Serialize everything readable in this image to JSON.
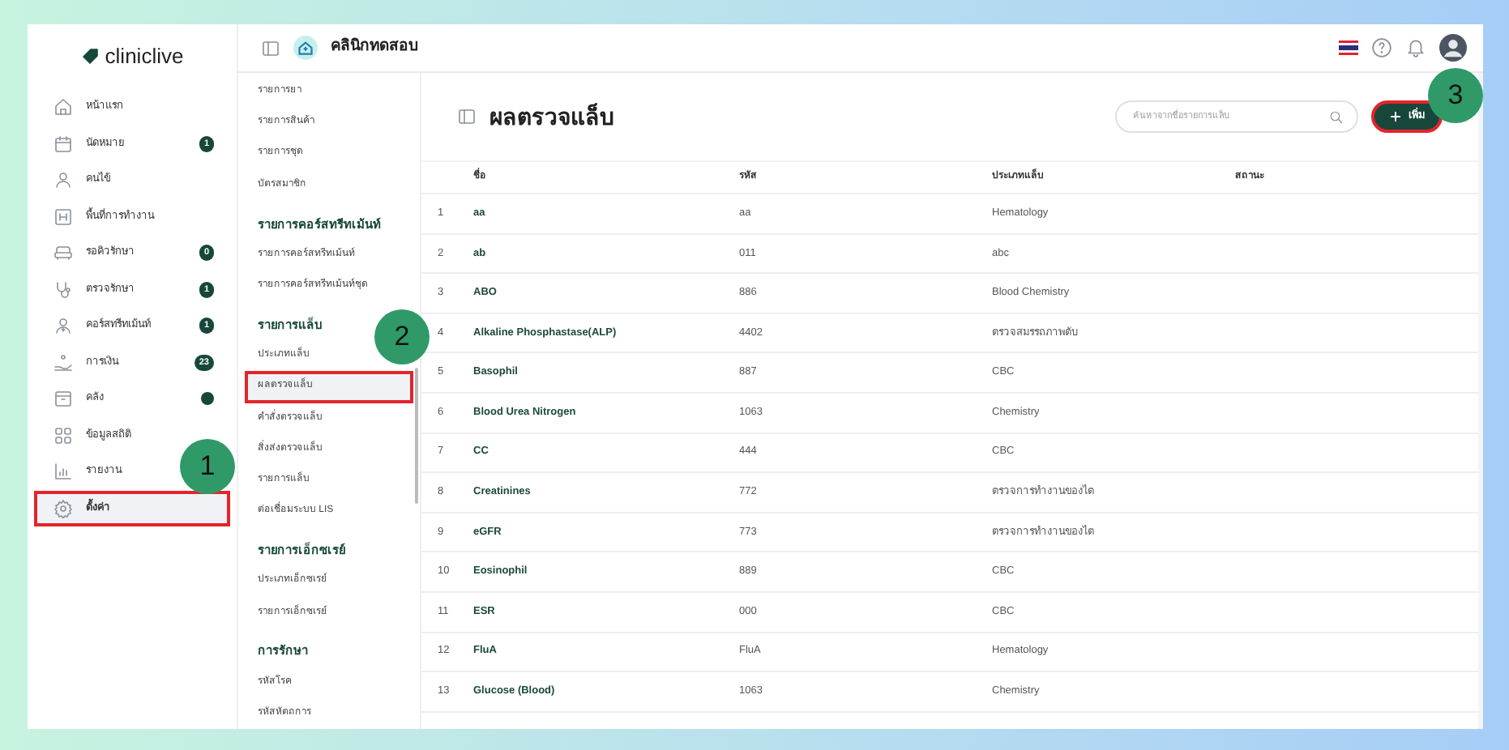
{
  "app": {
    "logo": "cliniclive",
    "clinic_name": "คลินิกทดสอบ"
  },
  "sidebar": {
    "items": [
      {
        "label": "หน้าแรก",
        "selected": false,
        "highlighted": false
      },
      {
        "label": "นัดหมาย",
        "badge": "1",
        "selected": false,
        "highlighted": false
      },
      {
        "label": "คนไข้",
        "selected": false,
        "highlighted": false
      },
      {
        "label": "พื้นที่การทำงาน",
        "selected": false,
        "highlighted": false
      },
      {
        "label": "รอคิวรักษา",
        "badge": "0",
        "selected": false,
        "highlighted": false
      },
      {
        "label": "ตรวจรักษา",
        "badge": "1",
        "selected": false,
        "highlighted": false
      },
      {
        "label": "คอร์สทรีทเม้นท์",
        "badge": "1",
        "selected": false,
        "highlighted": false
      },
      {
        "label": "การเงิน",
        "badge": "23",
        "selected": false,
        "highlighted": false
      },
      {
        "label": "คลัง",
        "dot": true,
        "selected": false,
        "highlighted": false
      },
      {
        "label": "ข้อมูลสถิติ",
        "selected": false,
        "highlighted": false
      },
      {
        "label": "รายงาน",
        "selected": false,
        "highlighted": false
      },
      {
        "label": "ตั้งค่า",
        "selected": true,
        "highlighted": true
      }
    ]
  },
  "submenu": {
    "groups": [
      {
        "items": [
          {
            "label": "รายการยา",
            "selected": false,
            "highlighted": false
          },
          {
            "label": "รายการสินค้า",
            "selected": false,
            "highlighted": false
          },
          {
            "label": "รายการชุด",
            "selected": false,
            "highlighted": false
          },
          {
            "label": "บัตรสมาชิก",
            "selected": false,
            "highlighted": false
          }
        ]
      },
      {
        "heading": "รายการคอร์สทรีทเม้นท์",
        "items": [
          {
            "label": "รายการคอร์สทรีทเม้นท์",
            "selected": false,
            "highlighted": false
          },
          {
            "label": "รายการคอร์สทรีทเม้นท์ชุด",
            "selected": false,
            "highlighted": false
          }
        ]
      },
      {
        "heading": "รายการแล็บ",
        "items": [
          {
            "label": "ประเภทแล็บ",
            "selected": false,
            "highlighted": false
          },
          {
            "label": "ผลตรวจแล็บ",
            "selected": true,
            "highlighted": true
          },
          {
            "label": "คำสั่งตรวจแล็บ",
            "selected": false,
            "highlighted": false
          },
          {
            "label": "สิ่งส่งตรวจแล็บ",
            "selected": false,
            "highlighted": false
          },
          {
            "label": "รายการแล็บ",
            "selected": false,
            "highlighted": false
          },
          {
            "label": "ต่อเชื่อมระบบ LIS",
            "selected": false,
            "highlighted": false
          }
        ]
      },
      {
        "heading": "รายการเอ็กซเรย์",
        "items": [
          {
            "label": "ประเภทเอ็กซเรย์",
            "selected": false,
            "highlighted": false
          },
          {
            "label": "รายการเอ็กซเรย์",
            "selected": false,
            "highlighted": false
          }
        ]
      },
      {
        "heading": "การรักษา",
        "items": [
          {
            "label": "รหัสโรค",
            "selected": false,
            "highlighted": false
          },
          {
            "label": "รหัสหัตถการ",
            "selected": false,
            "highlighted": false
          }
        ]
      }
    ]
  },
  "page": {
    "title": "ผลตรวจแล็บ",
    "search": {
      "placeholder": "ค้นหาจากชื่อรายการแล็บ"
    },
    "add_button": {
      "label": "เพิ่ม",
      "highlighted": true
    }
  },
  "table": {
    "columns": [
      "ชื่อ",
      "รหัส",
      "ประเภทแล็บ",
      "สถานะ"
    ],
    "rows": [
      {
        "no": "1",
        "name": "aa",
        "code": "aa",
        "type": "Hematology"
      },
      {
        "no": "2",
        "name": "ab",
        "code": "011",
        "type": "abc"
      },
      {
        "no": "3",
        "name": "ABO",
        "code": "886",
        "type": "Blood Chemistry"
      },
      {
        "no": "4",
        "name": "Alkaline Phosphastase(ALP)",
        "code": "4402",
        "type": "ตรวจสมรรถภาพตับ"
      },
      {
        "no": "5",
        "name": "Basophil",
        "code": "887",
        "type": "CBC"
      },
      {
        "no": "6",
        "name": "Blood Urea Nitrogen",
        "code": "1063",
        "type": "Chemistry"
      },
      {
        "no": "7",
        "name": "CC",
        "code": "444",
        "type": "CBC"
      },
      {
        "no": "8",
        "name": "Creatinines",
        "code": "772",
        "type": "ตรวจการทำงานของไต"
      },
      {
        "no": "9",
        "name": "eGFR",
        "code": "773",
        "type": "ตรวจการทำงานของไต"
      },
      {
        "no": "10",
        "name": "Eosinophil",
        "code": "889",
        "type": "CBC"
      },
      {
        "no": "11",
        "name": "ESR",
        "code": "000",
        "type": "CBC"
      },
      {
        "no": "12",
        "name": "FluA",
        "code": "FluA",
        "type": "Hematology"
      },
      {
        "no": "13",
        "name": "Glucose (Blood)",
        "code": "1063",
        "type": "Chemistry"
      }
    ]
  },
  "callouts": [
    {
      "number": "1"
    },
    {
      "number": "2"
    },
    {
      "number": "3"
    }
  ]
}
